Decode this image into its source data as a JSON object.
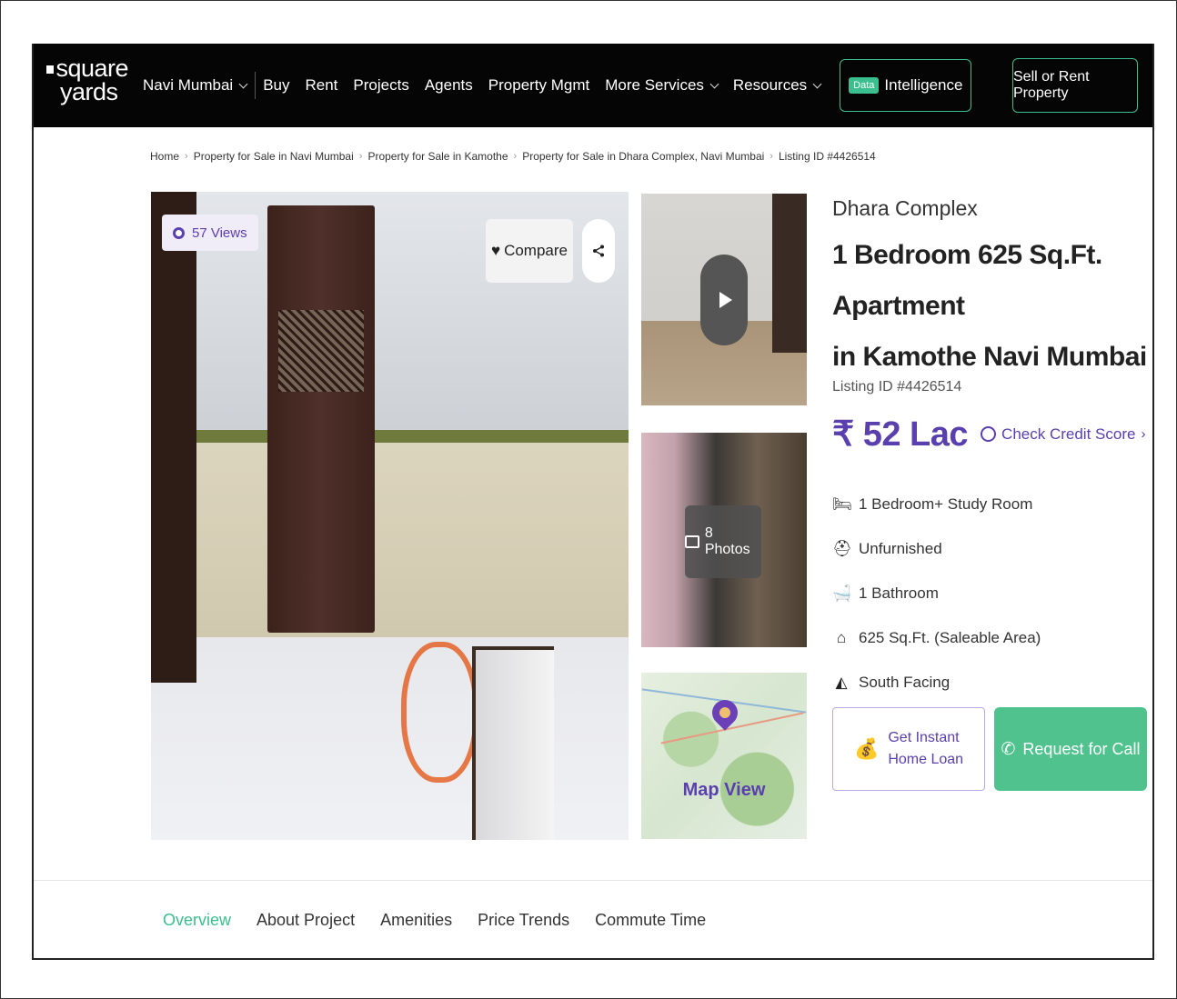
{
  "nav": {
    "logo_line1": "square",
    "logo_line2": "yards",
    "city": "Navi Mumbai",
    "links": [
      "Buy",
      "Rent",
      "Projects",
      "Agents",
      "Property Mgmt"
    ],
    "more_services": "More Services",
    "resources": "Resources",
    "data_badge": "Data",
    "intelligence": "Intelligence",
    "sell_button": "Sell or Rent Property"
  },
  "breadcrumb": [
    "Home",
    "Property for Sale in Navi Mumbai",
    "Property for Sale in Kamothe",
    "Property for Sale in Dhara Complex, Navi Mumbai",
    "Listing ID #4426514"
  ],
  "gallery": {
    "views": "57 Views",
    "compare": "Compare",
    "photos_count": "8 Photos",
    "map_view": "Map View"
  },
  "listing": {
    "project": "Dhara Complex",
    "title_line1": "1 Bedroom 625 Sq.Ft. Apartment",
    "title_line2": "in Kamothe Navi Mumbai",
    "listing_id": "Listing ID #4426514",
    "price": "₹ 52 Lac",
    "credit_link": "Check Credit Score",
    "features": [
      {
        "icon": "bed-icon",
        "text": "1 Bedroom+ Study Room"
      },
      {
        "icon": "sofa-icon",
        "text": "Unfurnished"
      },
      {
        "icon": "bathroom-icon",
        "text": "1 Bathroom"
      },
      {
        "icon": "home-icon",
        "text": "625 Sq.Ft. (Saleable Area)"
      },
      {
        "icon": "compass-icon",
        "text": "South Facing"
      }
    ],
    "loan_line1": "Get Instant",
    "loan_line2": "Home Loan",
    "call_button": "Request for Call"
  },
  "tabs": [
    "Overview",
    "About Project",
    "Amenities",
    "Price Trends",
    "Commute Time"
  ],
  "colors": {
    "brand_purple": "#5a3fae",
    "accent_green": "#3bbf8e",
    "nav_bg": "#050505"
  }
}
